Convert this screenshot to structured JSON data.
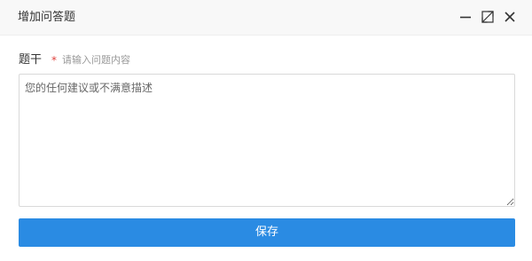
{
  "dialog": {
    "title": "增加问答题",
    "controls": {
      "minimize_icon": "minimize-icon",
      "maximize_icon": "maximize-icon",
      "close_icon": "close-icon"
    }
  },
  "form": {
    "field_label": "题干",
    "required_mark": "*",
    "field_hint": "请输入问题内容",
    "textarea_value": "",
    "textarea_placeholder": "您的任何建议或不满意描述"
  },
  "actions": {
    "save_label": "保存"
  },
  "colors": {
    "accent": "#2a8be3",
    "required": "#e0413d",
    "titlebar_bg": "#f8f8f8"
  }
}
